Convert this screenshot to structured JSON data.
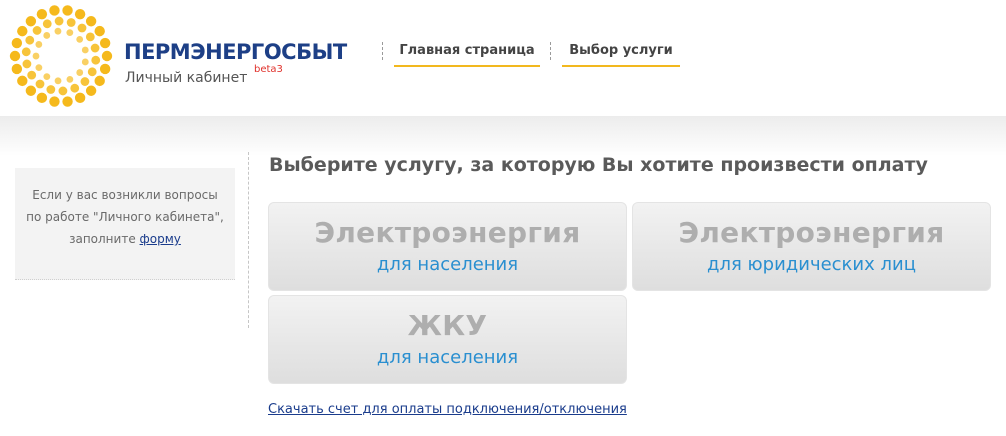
{
  "brand": {
    "name": "ПЕРМЭНЕРГОСБЫТ",
    "subtitle": "Личный кабинет",
    "beta": "beta3"
  },
  "nav": {
    "items": [
      {
        "label": "Главная страница"
      },
      {
        "label": "Выбор услуги"
      }
    ]
  },
  "sidebar": {
    "text": "Если у вас возникли вопросы по работе \"Личного кабинета\", заполните",
    "link": "форму"
  },
  "main": {
    "heading": "Выберите услугу, за которую Вы хотите произвести оплату",
    "tiles": [
      {
        "title": "Электроэнергия",
        "subtitle": "для населения"
      },
      {
        "title": "Электроэнергия",
        "subtitle": "для юридических лиц"
      },
      {
        "title": "ЖКУ",
        "subtitle": "для населения"
      }
    ],
    "download_link": "Скачать счет для оплаты подключения/отключения"
  },
  "colors": {
    "brand_blue": "#1d3f86",
    "accent_yellow": "#f2b81e",
    "link_blue": "#2a8fd0",
    "beta_red": "#e0312b"
  }
}
